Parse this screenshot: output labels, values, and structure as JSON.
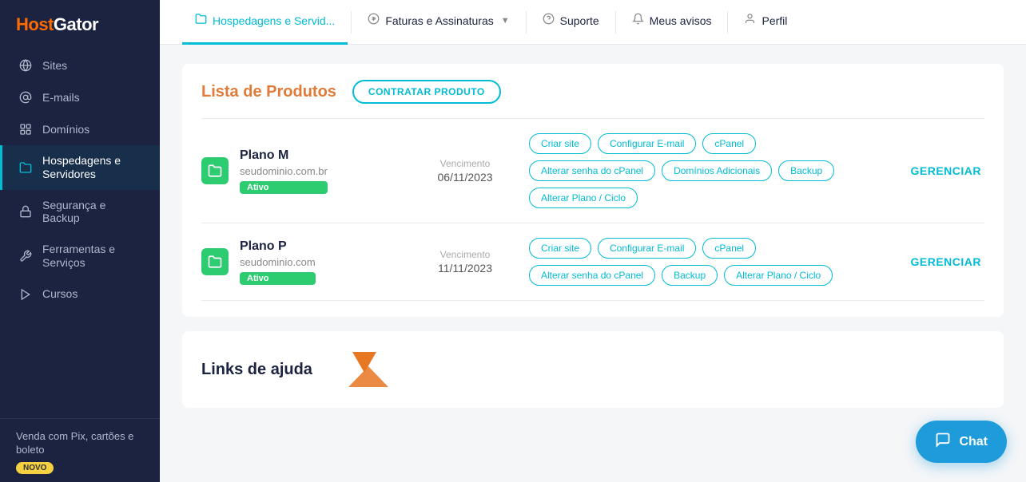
{
  "brand": {
    "name_part1": "Host",
    "name_part2": "Gator"
  },
  "sidebar": {
    "items": [
      {
        "id": "sites",
        "label": "Sites",
        "icon": "globe"
      },
      {
        "id": "emails",
        "label": "E-mails",
        "icon": "at"
      },
      {
        "id": "dominios",
        "label": "Domínios",
        "icon": "tag"
      },
      {
        "id": "hospedagens",
        "label": "Hospedagens e Servidores",
        "icon": "folder",
        "active": true
      },
      {
        "id": "seguranca",
        "label": "Segurança e Backup",
        "icon": "lock"
      },
      {
        "id": "ferramentas",
        "label": "Ferramentas e Serviços",
        "icon": "wrench"
      },
      {
        "id": "cursos",
        "label": "Cursos",
        "icon": "play"
      }
    ],
    "promo": {
      "title": "Venda com Pix, cartões e boleto",
      "badge": "NOVO"
    }
  },
  "topnav": {
    "items": [
      {
        "id": "hospedagens",
        "label": "Hospedagens e Servid...",
        "icon": "folder",
        "active": true
      },
      {
        "id": "faturas",
        "label": "Faturas e Assinaturas",
        "icon": "dollar",
        "has_chevron": true
      },
      {
        "id": "suporte",
        "label": "Suporte",
        "icon": "question"
      },
      {
        "id": "avisos",
        "label": "Meus avisos",
        "icon": "bell"
      },
      {
        "id": "perfil",
        "label": "Perfil",
        "icon": "user"
      }
    ]
  },
  "products_section": {
    "title": "Lista de Produtos",
    "contratar_label": "CONTRATAR PRODUTO",
    "products": [
      {
        "id": "plano_m",
        "name": "Plano M",
        "domain": "seudominio.com.br",
        "status": "Ativo",
        "venc_label": "Vencimento",
        "venc_date": "06/11/2023",
        "gerenciar_label": "GERENCIAR",
        "actions": [
          "Criar site",
          "Configurar E-mail",
          "cPanel",
          "Alterar senha do cPanel",
          "Domínios Adicionais",
          "Backup",
          "Alterar Plano / Ciclo"
        ]
      },
      {
        "id": "plano_p",
        "name": "Plano P",
        "domain": "seudominio.com",
        "status": "Ativo",
        "venc_label": "Vencimento",
        "venc_date": "11/11/2023",
        "gerenciar_label": "GERENCIAR",
        "actions": [
          "Criar site",
          "Configurar E-mail",
          "cPanel",
          "Alterar senha do cPanel",
          "Backup",
          "Alterar Plano / Ciclo"
        ]
      }
    ]
  },
  "links_section": {
    "title": "Links de ajuda"
  },
  "chat": {
    "label": "Chat",
    "icon": "chat-icon"
  }
}
